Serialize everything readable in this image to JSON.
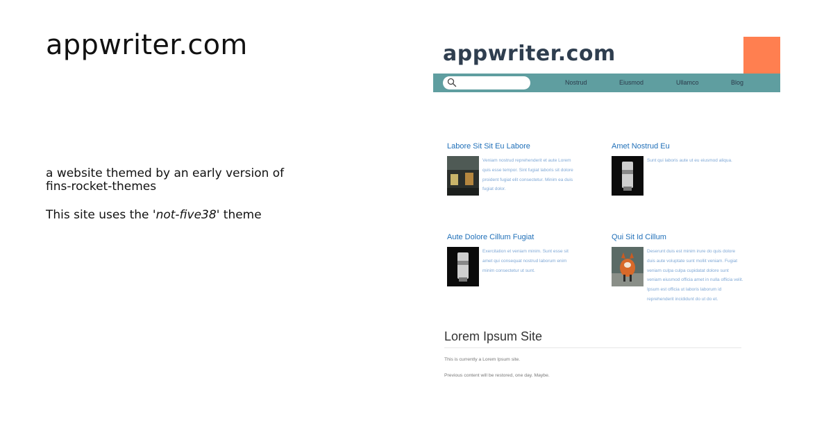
{
  "intro": {
    "title": "appwriter.com",
    "description": "a website themed by an early version of fins-rocket-themes",
    "theme_prefix": "This site uses the ",
    "theme_name": "'not-five38'",
    "theme_suffix": " theme"
  },
  "site": {
    "brand": "appwriter.com",
    "search": {
      "placeholder": ""
    },
    "nav": [
      "Nostrud",
      "Eiusmod",
      "Ullamco",
      "Blog"
    ],
    "colors": {
      "accent": "#ff7f50",
      "navbar": "#5f9ea0",
      "link": "#1f6fb8",
      "excerpt": "#7fa8d6"
    },
    "cards": [
      {
        "title": "Labore Sit Sit Eu Labore",
        "image": "storefront-photo",
        "text": "Veniam nostrud reprehenderit et aute Lorem quis esse tempor. Sint fugiat laboris sit dolore proident fugiat elit consectetur. Minim ea duis fugiat dolor."
      },
      {
        "title": "Amet Nostrud Eu",
        "image": "camera-lens-photo",
        "text": "Sunt qui laboris aute ut eu eiusmod aliqua."
      },
      {
        "title": "Aute Dolore Cillum Fugiat",
        "image": "camera-lens-photo",
        "text": "Exercitation et veniam minim. Sunt esse sit amet qui consequat nostrud laborum enim minim consectetur ut sunt."
      },
      {
        "title": "Qui Sit Id Cillum",
        "image": "fox-photo",
        "text": "Deserunt duis est minim irure do quis dolore duis aute voluptate sunt mollit veniam. Fugiat veniam culpa culpa cupidatat dolore sunt veniam eiusmod officia amet in nulla officia velit. Ipsum est officia ut laboris laborum id reprehenderit incididunt do ut do et."
      }
    ],
    "section": {
      "title": "Lorem Ipsum Site",
      "line1": "This is currently a Lorem Ipsum site.",
      "line2": "Previous content will be restored, one day. Maybe."
    }
  }
}
